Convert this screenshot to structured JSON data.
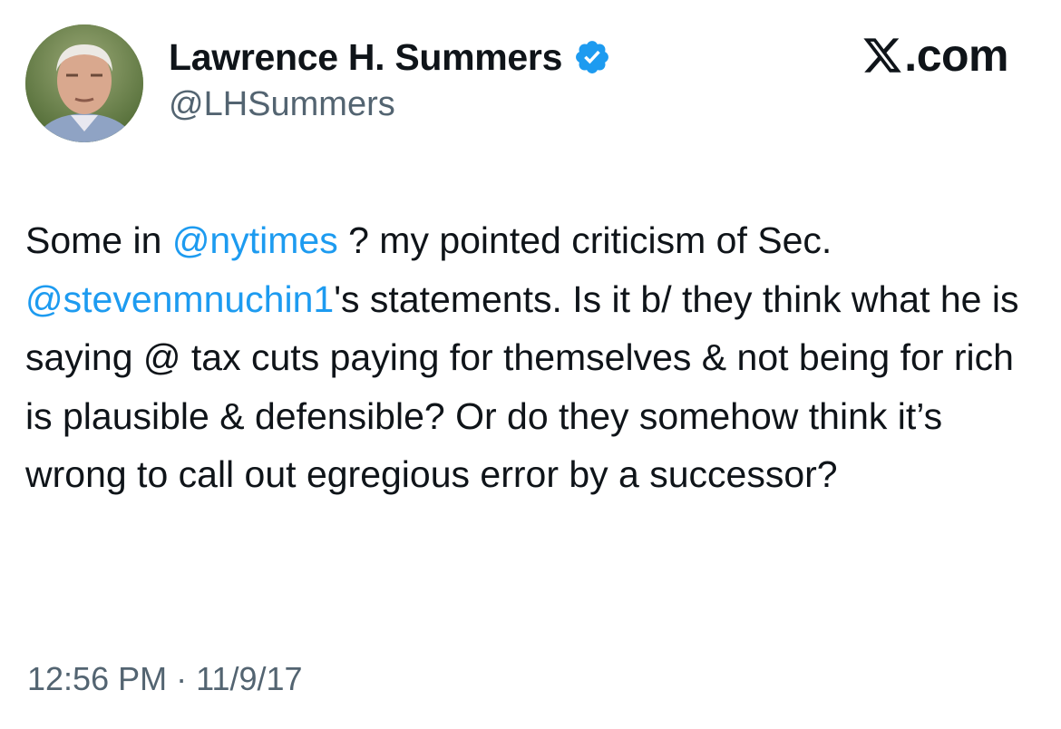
{
  "header": {
    "display_name": "Lawrence H. Summers",
    "handle": "@LHSummers",
    "brand": ".com"
  },
  "tweet": {
    "segments": {
      "s1": "Some in ",
      "m1": "@nytimes",
      "s2": " ? my pointed criticism of Sec. ",
      "m2": "@stevenmnuchin1",
      "s3": "'s statements.  Is it b/ they think what he is saying @ tax cuts paying for themselves & not being for rich is plausible & defensible? Or do they somehow think it’s wrong to call out egregious error by a successor?"
    }
  },
  "meta": {
    "time": "12:56 PM",
    "separator": " · ",
    "date": "11/9/17"
  },
  "colors": {
    "mention": "#1d9bf0",
    "verified": "#1d9bf0",
    "secondary_text": "#536471",
    "primary_text": "#0f1419"
  },
  "icons": {
    "avatar": "profile-photo",
    "verified": "verified-badge-icon",
    "brand": "x-logo-icon"
  }
}
